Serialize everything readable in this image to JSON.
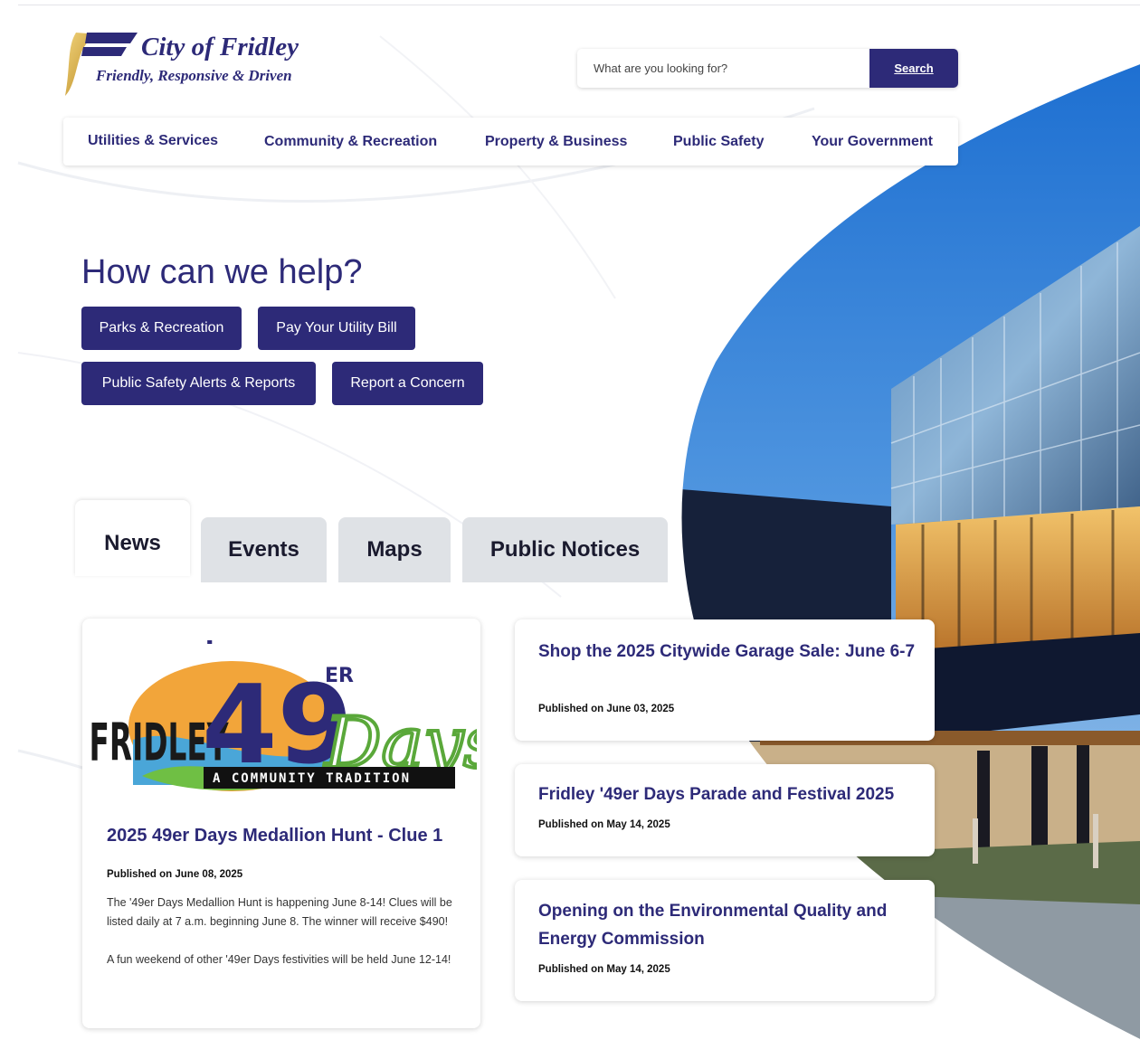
{
  "logo": {
    "title": "City of Fridley",
    "tagline": "Friendly, Responsive & Driven",
    "icon": "fridley-f-logo-icon"
  },
  "search": {
    "placeholder": "What are you looking for?",
    "button_label": "Search"
  },
  "nav": {
    "items": [
      {
        "label": "Utilities & Services"
      },
      {
        "label": "Community & Recreation"
      },
      {
        "label": "Property & Business"
      },
      {
        "label": "Public Safety"
      },
      {
        "label": "Your Government"
      }
    ]
  },
  "help": {
    "title": "How can we help?",
    "buttons": [
      {
        "label": "Parks & Recreation"
      },
      {
        "label": "Pay Your Utility Bill"
      },
      {
        "label": "Public Safety Alerts & Reports"
      },
      {
        "label": "Report a Concern"
      }
    ]
  },
  "tabs": [
    {
      "label": "News",
      "active": true
    },
    {
      "label": "Events",
      "active": false
    },
    {
      "label": "Maps",
      "active": false
    },
    {
      "label": "Public Notices",
      "active": false
    }
  ],
  "featured": {
    "image": {
      "word_left": "FRIDLEY",
      "apostrophe": "'",
      "number": "49",
      "suffix": "ER",
      "word_right": "Days",
      "banner": "A COMMUNITY TRADITION"
    },
    "title": "2025 49er Days Medallion Hunt - Clue 1",
    "published": "Published on June 08, 2025",
    "body": [
      "The '49er Days Medallion Hunt is happening June 8-14! Clues will be listed daily at 7 a.m. beginning June 8. The winner will receive $490!",
      "A fun weekend of other '49er Days festivities will be held June 12-14!"
    ]
  },
  "news": [
    {
      "title": "Shop the 2025 Citywide Garage Sale: June 6-7",
      "published": "Published on June 03, 2025"
    },
    {
      "title": "Fridley '49er Days Parade and Festival 2025",
      "published": "Published on May 14, 2025"
    },
    {
      "title": "Opening on the Environmental Quality and Energy Commission",
      "published": "Published on May 14, 2025"
    }
  ],
  "colors": {
    "brand_navy": "#2d2a78",
    "brand_gold": "#c9a227",
    "tab_inactive": "#dfe2e6"
  }
}
